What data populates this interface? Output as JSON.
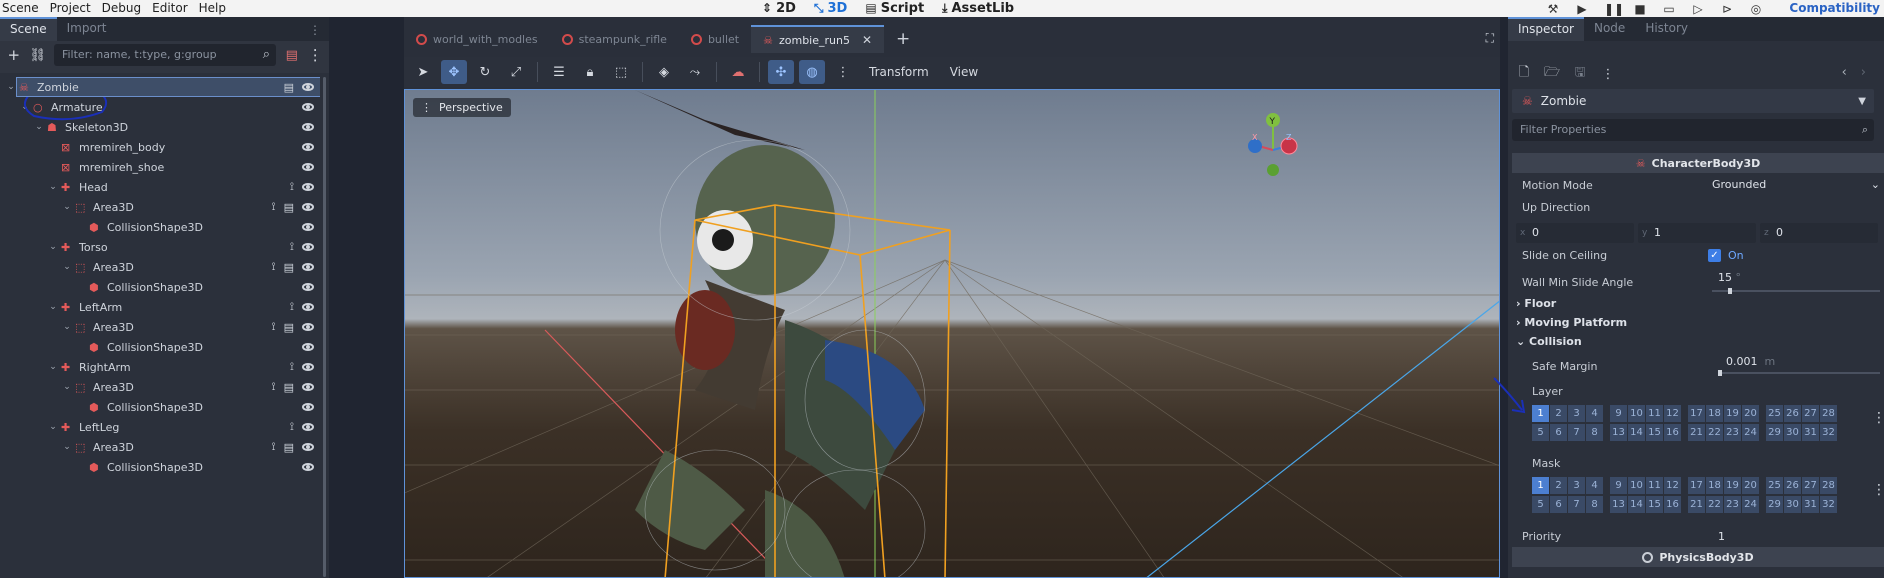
{
  "menu": [
    "Scene",
    "Project",
    "Debug",
    "Editor",
    "Help"
  ],
  "main_screens": [
    {
      "label": "2D",
      "active": false
    },
    {
      "label": "3D",
      "active": true
    },
    {
      "label": "Script",
      "active": false
    },
    {
      "label": "AssetLib",
      "active": false
    }
  ],
  "renderer": "Compatibility",
  "scene_dock": {
    "tabs": [
      "Scene",
      "Import"
    ],
    "filter_placeholder": "Filter: name, t:type, g:group",
    "nodes": [
      {
        "name": "Zombie",
        "depth": 0
      },
      {
        "name": "Armature",
        "depth": 1
      },
      {
        "name": "Skeleton3D",
        "depth": 2
      },
      {
        "name": "mremireh_body",
        "depth": 3
      },
      {
        "name": "mremireh_shoe",
        "depth": 3
      },
      {
        "name": "Head",
        "depth": 3
      },
      {
        "name": "Area3D",
        "depth": 4
      },
      {
        "name": "CollisionShape3D",
        "depth": 5
      },
      {
        "name": "Torso",
        "depth": 3
      },
      {
        "name": "Area3D",
        "depth": 4
      },
      {
        "name": "CollisionShape3D",
        "depth": 5
      },
      {
        "name": "LeftArm",
        "depth": 3
      },
      {
        "name": "Area3D",
        "depth": 4
      },
      {
        "name": "CollisionShape3D",
        "depth": 5
      },
      {
        "name": "RightArm",
        "depth": 3
      },
      {
        "name": "Area3D",
        "depth": 4
      },
      {
        "name": "CollisionShape3D",
        "depth": 5
      },
      {
        "name": "LeftLeg",
        "depth": 3
      },
      {
        "name": "Area3D",
        "depth": 4
      },
      {
        "name": "CollisionShape3D",
        "depth": 5
      }
    ]
  },
  "viewport": {
    "tabs": [
      {
        "label": "world_with_modles",
        "active": false
      },
      {
        "label": "steampunk_rifle",
        "active": false
      },
      {
        "label": "bullet",
        "active": false
      },
      {
        "label": "zombie_run5",
        "active": true
      }
    ],
    "menus": [
      "Transform",
      "View"
    ],
    "perspective_label": "Perspective",
    "gizmo_axes": {
      "y": "Y",
      "x": "X",
      "z": "Z"
    }
  },
  "inspector": {
    "tabs": [
      "Inspector",
      "Node",
      "History"
    ],
    "object_name": "Zombie",
    "filter_placeholder": "Filter Properties",
    "class_header": "CharacterBody3D",
    "motion_mode": {
      "label": "Motion Mode",
      "value": "Grounded"
    },
    "up_direction": {
      "label": "Up Direction",
      "x_label": "x",
      "x": "0",
      "y_label": "y",
      "y": "1",
      "z_label": "z",
      "z": "0"
    },
    "slide_on_ceiling": {
      "label": "Slide on Ceiling",
      "value": "On"
    },
    "wall_min_slide_angle": {
      "label": "Wall Min Slide Angle",
      "value": "15",
      "unit": "°"
    },
    "groups": [
      "Floor",
      "Moving Platform",
      "Collision"
    ],
    "safe_margin": {
      "label": "Safe Margin",
      "value": "0.001",
      "unit": "m"
    },
    "layer_label": "Layer",
    "mask_label": "Mask",
    "layer_active": [
      1
    ],
    "mask_active": [
      1
    ],
    "priority": {
      "label": "Priority",
      "value": "1"
    },
    "next_header": "PhysicsBody3D"
  },
  "colors": {
    "accent": "#4c7fd1",
    "annotation": "#1a2fb8",
    "node_red": "#e45a5a",
    "bbox_orange": "#f0a020"
  }
}
